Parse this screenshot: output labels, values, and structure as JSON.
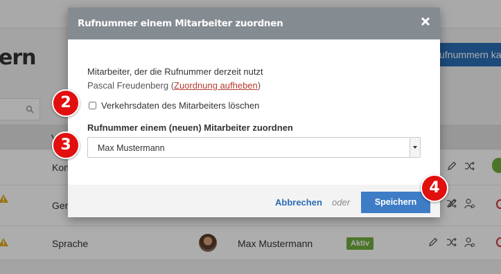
{
  "background": {
    "page_title": "ern",
    "buy_button": "Rufnummern kaufen",
    "column_header_partial": "V",
    "rows": [
      {
        "name": "Kon",
        "user": "",
        "status": ""
      },
      {
        "name": "Gen",
        "user": "",
        "status": ""
      },
      {
        "name": "Sprache",
        "user": "Max Mustermann",
        "status": "Aktiv"
      }
    ]
  },
  "modal": {
    "title": "Rufnummer einem Mitarbeiter zuordnen",
    "current_label": "Mitarbeiter, der die Rufnummer derzeit nutzt",
    "current_user": "Pascal Freudenberg",
    "unassign_link": "Zuordnung aufheben",
    "paren_open": "(",
    "paren_close": ")",
    "delete_checkbox_label": "Verkehrsdaten des Mitarbeiters löschen",
    "delete_checkbox_checked": false,
    "assign_label": "Rufnummer einem (neuen) Mitarbeiter zuordnen",
    "assign_select_value": "Max Mustermann",
    "cancel_label": "Abbrechen",
    "or_label": "oder",
    "save_label": "Speichern"
  },
  "markers": [
    "2",
    "3",
    "4"
  ],
  "colors": {
    "accent": "#3e7cc6",
    "header": "#848b91",
    "link_red": "#b53a2e",
    "marker": "#e20f0f",
    "badge_green": "#6fae3e"
  }
}
